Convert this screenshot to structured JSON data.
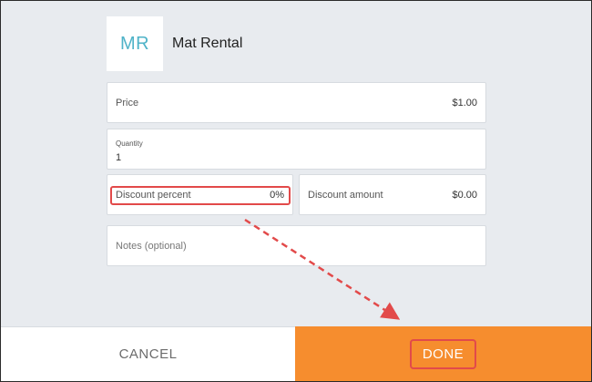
{
  "item": {
    "initials": "MR",
    "title": "Mat Rental"
  },
  "fields": {
    "price_label": "Price",
    "price_value": "$1.00",
    "quantity_label": "Quantity",
    "quantity_value": "1",
    "discount_percent_label": "Discount percent",
    "discount_percent_value": "0%",
    "discount_amount_label": "Discount amount",
    "discount_amount_value": "$0.00",
    "notes_placeholder": "Notes (optional)"
  },
  "footer": {
    "cancel_label": "CANCEL",
    "done_label": "DONE"
  },
  "colors": {
    "done_bg": "#f68d2e",
    "avatar_text": "#4fb3c8",
    "highlight": "#e24a4a"
  }
}
